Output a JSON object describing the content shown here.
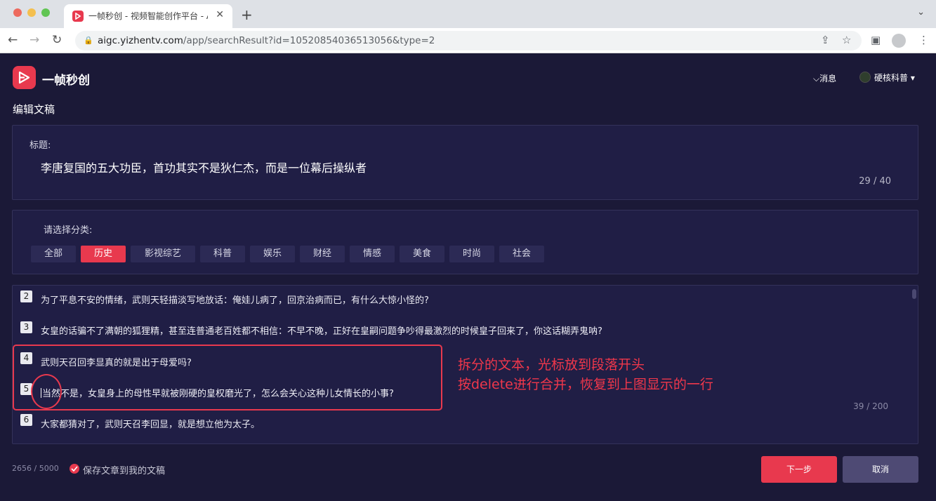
{
  "browser": {
    "tab_title": "一帧秒创 - 视频智能创作平台 - A",
    "url_host": "aigc.yizhentv.com",
    "url_path": "/app/searchResult?id=10520854036513056&type=2"
  },
  "header": {
    "app_name": "一帧秒创",
    "messages_label": "消息",
    "user_name": "硬核科普"
  },
  "page_title": "编辑文稿",
  "title_section": {
    "label": "标题:",
    "value": "李唐复国的五大功臣，首功其实不是狄仁杰，而是一位幕后操纵者",
    "count": "29 / 40"
  },
  "category_section": {
    "label": "请选择分类:",
    "items": [
      "全部",
      "历史",
      "影视综艺",
      "科普",
      "娱乐",
      "财经",
      "情感",
      "美食",
      "时尚",
      "社会"
    ],
    "selected": "历史"
  },
  "paragraphs": [
    {
      "num": "2",
      "text": "为了平息不安的情绪，武则天轻描淡写地放话：俺娃儿病了，回京治病而已，有什么大惊小怪的?"
    },
    {
      "num": "3",
      "text": "女皇的话骗不了满朝的狐狸精，甚至连普通老百姓都不相信：不早不晚，正好在皇嗣问题争吵得最激烈的时候皇子回来了，你这话糊弄鬼呐?"
    },
    {
      "num": "4",
      "text": "武则天召回李显真的就是出于母爱吗?"
    },
    {
      "num": "5",
      "text": "当然不是，女皇身上的母性早就被刚硬的皇权磨光了，怎么会关心这种儿女情长的小事?"
    },
    {
      "num": "6",
      "text": "大家都猜对了，武则天召李回显，就是想立他为太子。"
    }
  ],
  "paragraph_count": "39 / 200",
  "annotation": {
    "line1": "拆分的文本，光标放到段落开头",
    "line2": "按delete进行合并，恢复到上图显示的一行"
  },
  "footer": {
    "word_count": "2656 / 5000",
    "save_label": "保存文章到我的文稿",
    "next_button": "下一步",
    "cancel_button": "取消"
  },
  "colors": {
    "accent": "#e8394e",
    "background": "#1b1937",
    "panel": "#201e45"
  }
}
